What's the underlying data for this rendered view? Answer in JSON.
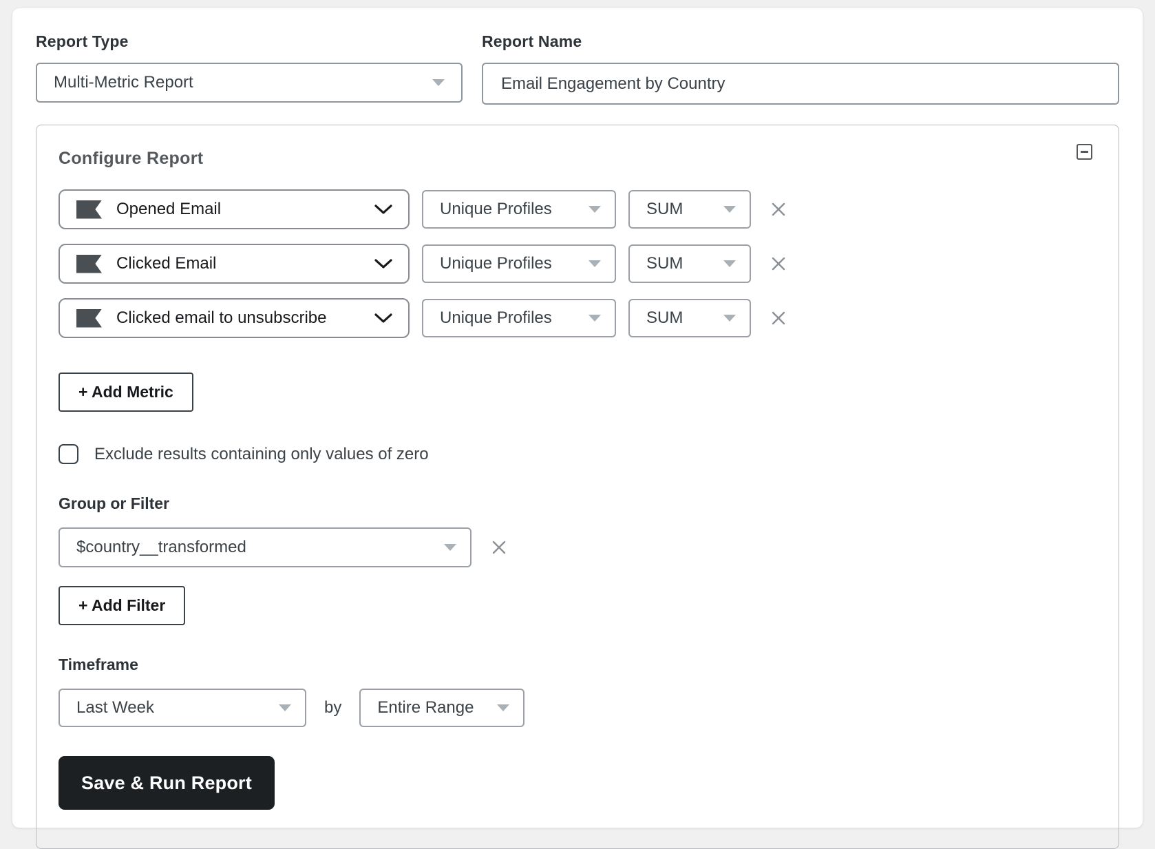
{
  "report_type": {
    "label": "Report Type",
    "value": "Multi-Metric Report"
  },
  "report_name": {
    "label": "Report Name",
    "value": "Email Engagement by Country"
  },
  "configure": {
    "title": "Configure Report",
    "collapse_icon": "minus-square-icon",
    "metrics": [
      {
        "metric": "Opened Email",
        "measurement": "Unique Profiles",
        "aggregation": "SUM"
      },
      {
        "metric": "Clicked Email",
        "measurement": "Unique Profiles",
        "aggregation": "SUM"
      },
      {
        "metric": "Clicked email to unsubscribe",
        "measurement": "Unique Profiles",
        "aggregation": "SUM"
      }
    ],
    "add_metric_label": "+ Add Metric",
    "exclude_zero": {
      "label": "Exclude results containing only values of zero",
      "checked": false
    },
    "group_or_filter": {
      "label": "Group or Filter",
      "value": "$country__transformed"
    },
    "add_filter_label": "+ Add Filter",
    "timeframe": {
      "label": "Timeframe",
      "range": "Last Week",
      "by_label": "by",
      "grouping": "Entire Range"
    },
    "save_button_label": "Save & Run Report"
  },
  "colors": {
    "page_background": "#f0f0f1",
    "card_background": "#ffffff",
    "card_border": "#b7bbbf",
    "input_border": "#8f969c",
    "metric_border": "#878d92",
    "mini_border": "#9aa0a5",
    "flag_icon": "#4a4f54",
    "text_dark": "#17191c",
    "text_medium": "#3b4248",
    "heading_gray": "#54595e",
    "caret_gray": "#a9b0b6",
    "x_icon_gray": "#8a9096",
    "save_button_background": "#1d2023",
    "save_button_text": "#ffffff"
  }
}
